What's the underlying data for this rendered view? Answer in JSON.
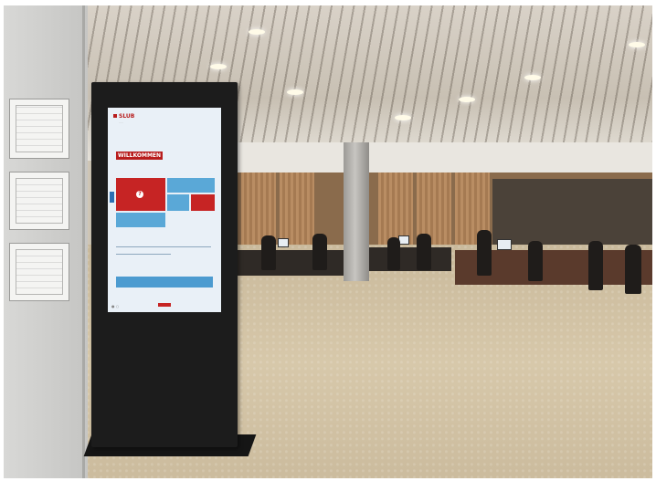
{
  "kiosk": {
    "brand_name": "SLUB",
    "welcome_title": "WILLKOMMEN",
    "tiles": [
      {
        "color": "#c62424"
      },
      {
        "color": "#5aa8d7"
      },
      {
        "color": "#c62424"
      },
      {
        "color": "#5aa8d7"
      },
      {
        "color": "#5aa8d7"
      }
    ]
  },
  "colors": {
    "brand_red": "#b81d1d",
    "tile_blue": "#5aa8d7",
    "screen_bg": "#e9f0f7"
  }
}
